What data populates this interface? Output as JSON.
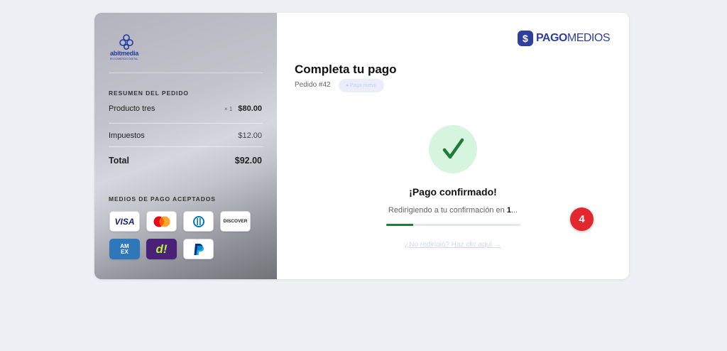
{
  "merchant": {
    "logo_text": "abitmedia",
    "logo_tagline": "EN COMERCIO DIGITAL"
  },
  "summary": {
    "title": "RESUMEN DEL PEDIDO",
    "items": [
      {
        "name": "Producto tres",
        "qty": "× 1",
        "price": "$80.00"
      }
    ],
    "taxes_label": "Impuestos",
    "taxes_value": "$12.00",
    "total_label": "Total",
    "total_value": "$92.00"
  },
  "payment_methods": {
    "title": "MEDIOS DE PAGO ACEPTADOS",
    "items": [
      {
        "name": "visa",
        "label": "VISA"
      },
      {
        "name": "mastercard",
        "label": ""
      },
      {
        "name": "diners",
        "label": ""
      },
      {
        "name": "discover",
        "label": "DISCOVER"
      },
      {
        "name": "amex",
        "label": "AM EX"
      },
      {
        "name": "dlocal",
        "label": "d!"
      },
      {
        "name": "paypal",
        "label": ""
      }
    ]
  },
  "brand": {
    "name_bold": "PAGO",
    "name_light": "MEDIOS",
    "icon": "dollar-icon",
    "color": "#2f3f9e"
  },
  "checkout": {
    "title": "Completa tu pago",
    "order": "Pedido #42",
    "badge": "● Pago nuevo"
  },
  "status": {
    "icon": "checkmark-icon",
    "title": "¡Pago confirmado!",
    "redirect_prefix": "Redirigiendo a tu confirmación en ",
    "countdown": "1",
    "redirect_suffix": "...",
    "progress": 0.2,
    "link": "¿No redirigió? Haz clic aquí →",
    "success_color": "#1f7a3c"
  },
  "marker": {
    "label": "4",
    "color": "#e2282e"
  }
}
